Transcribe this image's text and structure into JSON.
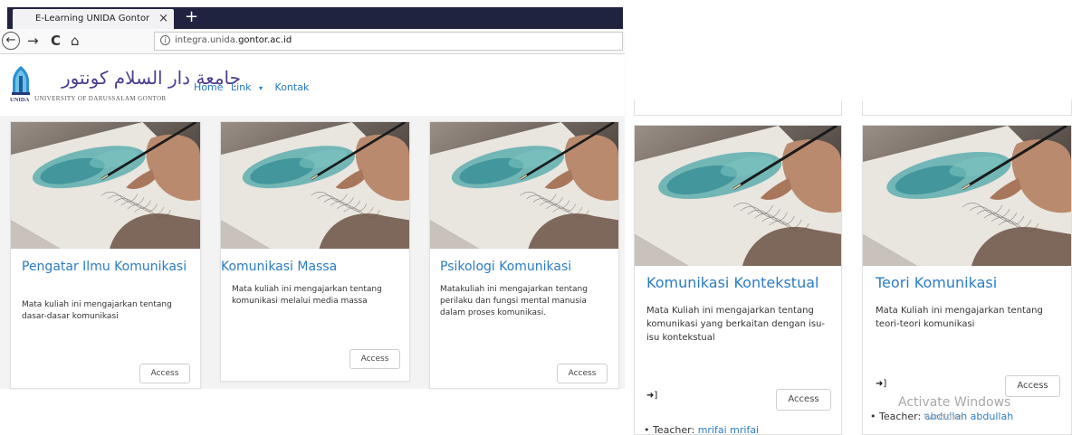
{
  "browser": {
    "tab_title": "E-Learning UNIDA Gontor",
    "tab_close": "×",
    "new_tab": "+",
    "back": "←",
    "forward": "→",
    "reload": "C",
    "home": "⌂",
    "info": "i",
    "url_prefix": "integra.unida.",
    "url_domain": "gontor.ac.id"
  },
  "site": {
    "logo_arabic": "جامعة دار السلام كونتور",
    "logo_english": "UNIVERSITY OF DARUSSALAM GONTOR",
    "logo_short": "UNIDA",
    "menu": [
      {
        "label": "Home"
      },
      {
        "label": "Link"
      },
      {
        "label": "Kontak"
      }
    ],
    "link_caret": "▾"
  },
  "courses": [
    {
      "title": "Pengatar Ilmu Komunikasi",
      "description": "Mata kuliah ini mengajarkan tentang dasar-dasar komunikasi",
      "button": "Access"
    },
    {
      "title": "Komunikasi Massa",
      "description": "Mata kuliah ini mengajarkan tentang komunikasi melalui media massa",
      "button": "Access"
    },
    {
      "title": "Psikologi Komunikasi",
      "description": "Matakuliah ini mengajarkan tentang perilaku dan fungsi mental manusia dalam proses komunikasi.",
      "button": "Access"
    },
    {
      "title": "Komunikasi Kontekstual",
      "description": "Mata Kuliah ini mengajarkan tentang komunikasi yang berkaitan dengan isu-isu kontekstual",
      "button": "Access",
      "enroll_icon": "➜]",
      "teacher_label": "Teacher:",
      "teacher_name": "mrifai mrifai"
    },
    {
      "title": "Teori Komunikasi",
      "description": "Mata Kuliah ini mengajarkan tentang teori-teori komunikasi",
      "button": "Access",
      "enroll_icon": "➜]",
      "teacher_label": "Teacher:",
      "teacher_name": "abdullah abdullah"
    }
  ],
  "watermark": {
    "line1": "Activate Windows",
    "line2": "Windows."
  },
  "colors": {
    "link_blue": "#2b7cc4",
    "tab_bar": "#202340",
    "page_gray": "#f3f3f3"
  }
}
